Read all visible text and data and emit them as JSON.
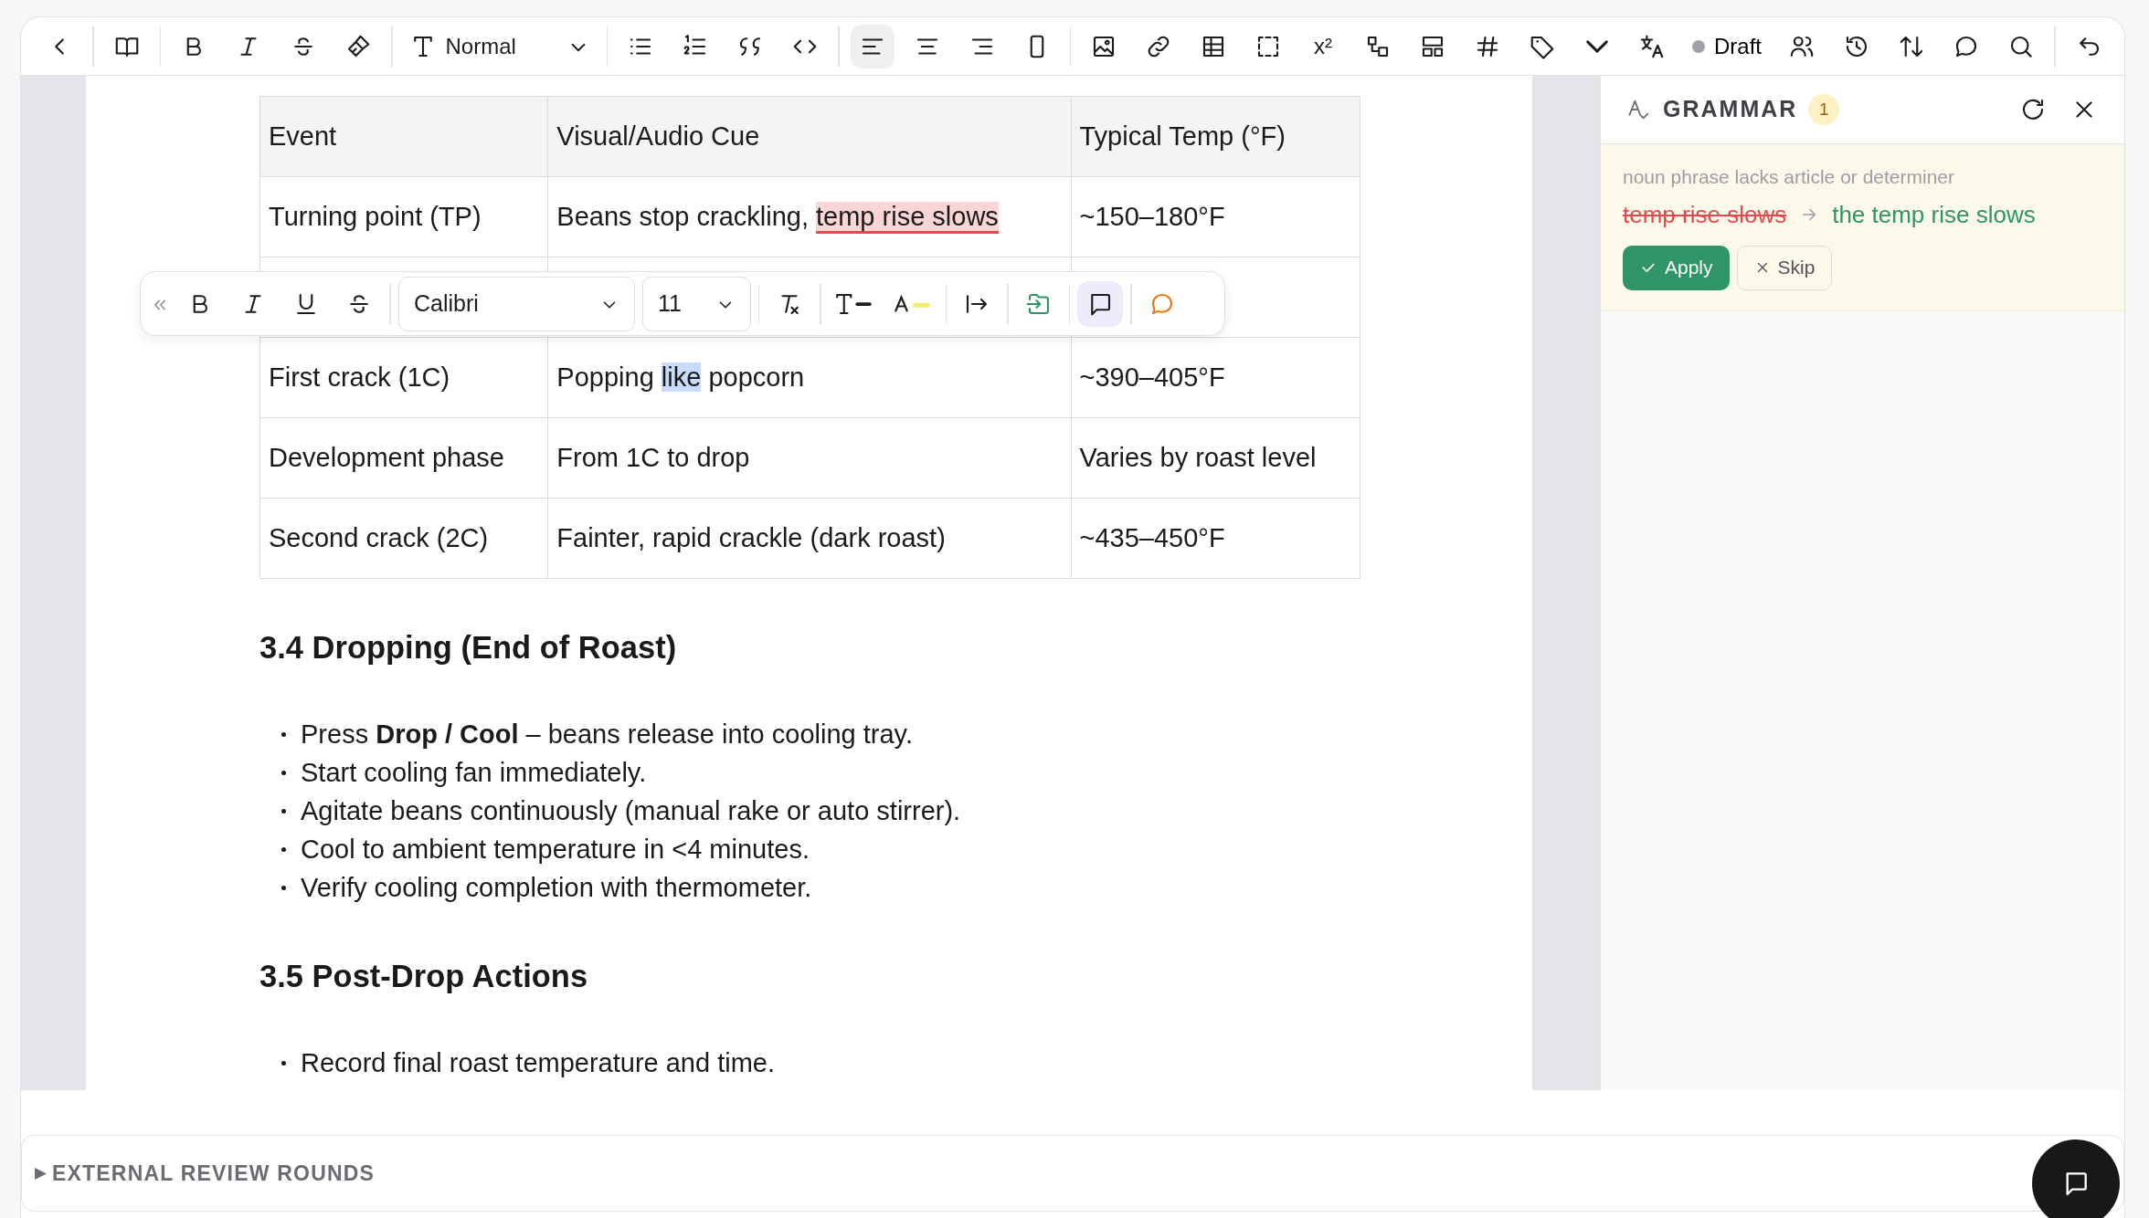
{
  "toolbar": {
    "style_value": "Normal",
    "align_buttons": [
      {
        "selected": true
      },
      {
        "selected": false
      },
      {
        "selected": false
      },
      {
        "selected": false
      }
    ],
    "superscript": "x²",
    "status": "Draft"
  },
  "document": {
    "table": {
      "columns": [
        "Event",
        "Visual/Audio Cue",
        "Typical Temp (°F)"
      ],
      "rows": [
        {
          "event": "Turning point (TP)",
          "cue": [
            {
              "text": "Beans stop crackling, ",
              "kind": "plain"
            },
            {
              "text": "temp rise slows",
              "kind": "grammar"
            }
          ],
          "temp": "~150–180°F"
        },
        {
          "event": "First crack (1C)",
          "cue": [
            {
              "text": "Popping ",
              "kind": "plain"
            },
            {
              "text": "like",
              "kind": "selection"
            },
            {
              "text": " popcorn",
              "kind": "plain"
            }
          ],
          "temp": "~390–405°F"
        },
        {
          "event": "Development phase",
          "cue": [
            {
              "text": "From 1C to drop",
              "kind": "plain"
            }
          ],
          "temp": "Varies by roast level"
        },
        {
          "event": "Second crack (2C)",
          "cue": [
            {
              "text": "Fainter, rapid crackle (dark roast)",
              "kind": "plain"
            }
          ],
          "temp": "~435–450°F"
        }
      ]
    },
    "sections": [
      {
        "heading": "3.4 Dropping (End of Roast)",
        "bullets": [
          "Press **Drop / Cool** – beans release into cooling tray.",
          "Start cooling fan immediately.",
          "Agitate beans continuously (manual rake or auto stirrer).",
          "Cool to ambient temperature in <4 minutes.",
          "Verify cooling completion with thermometer."
        ]
      },
      {
        "heading": "3.5 Post-Drop Actions",
        "bullets": [
          "Record final roast temperature and time."
        ]
      }
    ]
  },
  "floating_toolbar": {
    "collapse": "«",
    "font": "Calibri",
    "size": "11",
    "comment_active": true
  },
  "sidebar": {
    "title": "GRAMMAR",
    "count": "1",
    "suggestions": [
      {
        "reason": "noun phrase lacks article or determiner",
        "original": "temp rise slows",
        "replacement": "the temp rise slows",
        "apply": "Apply",
        "skip": "Skip"
      }
    ]
  },
  "footer": {
    "toggle": "▶",
    "label": "EXTERNAL REVIEW ROUNDS"
  }
}
